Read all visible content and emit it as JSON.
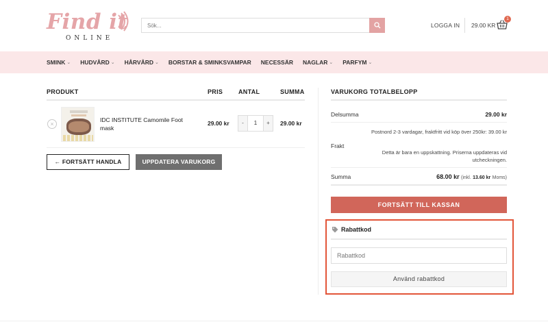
{
  "header": {
    "logo_main": "Find it",
    "logo_sub": "ONLINE",
    "search_placeholder": "Sök...",
    "login_label": "LOGGA IN",
    "cart_total": "29.00 KR",
    "cart_count": "1",
    "accent_color": "#e3a3a3"
  },
  "nav": {
    "items": [
      {
        "label": "SMINK",
        "dropdown": true
      },
      {
        "label": "HUDVÅRD",
        "dropdown": true
      },
      {
        "label": "HÅRVÅRD",
        "dropdown": true
      },
      {
        "label": "BORSTAR & SMINKSVAMPAR",
        "dropdown": false
      },
      {
        "label": "NECESSÄR",
        "dropdown": false
      },
      {
        "label": "NAGLAR",
        "dropdown": true
      },
      {
        "label": "PARFYM",
        "dropdown": true
      }
    ]
  },
  "cart": {
    "headers": {
      "product": "PRODUKT",
      "price": "PRIS",
      "qty": "ANTAL",
      "sum": "SUMMA"
    },
    "items": [
      {
        "name": "IDC INSTITUTE Camomile Foot mask",
        "price": "29.00 kr",
        "qty": "1",
        "sum": "29.00 kr"
      }
    ],
    "continue_label": "← FORTSÄTT HANDLA",
    "update_label": "UPPDATERA VARUKORG"
  },
  "totals": {
    "title": "VARUKORG TOTALBELOPP",
    "subtotal_label": "Delsumma",
    "subtotal_value": "29.00 kr",
    "shipping_label": "Frakt",
    "shipping_method": "Postnord 2-3 vardagar, fraktfritt vid köp över 250kr:",
    "shipping_price": "39.00 kr",
    "shipping_note": "Detta är bara en uppskattning. Priserna uppdateras vid utcheckningen.",
    "total_label": "Summa",
    "total_value": "68.00 kr",
    "total_tax_prefix": "(inkl.",
    "total_tax_value": "13.60 kr",
    "total_tax_suffix": "Moms)",
    "checkout_label": "FORTSÄTT TILL KASSAN",
    "checkout_color": "#d1665a"
  },
  "coupon": {
    "title": "Rabattkod",
    "placeholder": "Rabattkod",
    "apply_label": "Använd rabattkod",
    "highlight_color": "#e25438"
  }
}
